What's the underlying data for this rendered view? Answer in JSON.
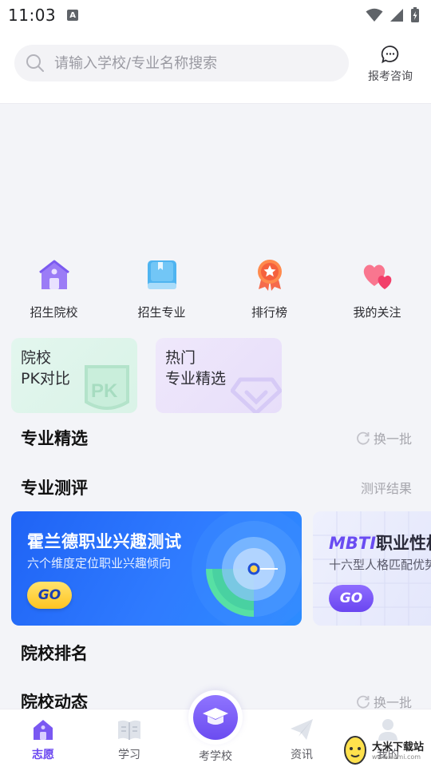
{
  "status_bar": {
    "time": "11:03",
    "notification_letter": "A"
  },
  "header": {
    "search_placeholder": "请输入学校/专业名称搜索",
    "consult_label": "报考咨询"
  },
  "quick_links": [
    {
      "label": "招生院校",
      "icon": "school-building-icon"
    },
    {
      "label": "招生专业",
      "icon": "book-icon"
    },
    {
      "label": "排行榜",
      "icon": "ranking-medal-icon"
    },
    {
      "label": "我的关注",
      "icon": "hearts-icon"
    }
  ],
  "feature_cards": [
    {
      "line1": "院校",
      "line2": "PK对比",
      "deco": "PK"
    },
    {
      "line1": "热门",
      "line2": "专业精选"
    }
  ],
  "sections": {
    "major_picks": {
      "title": "专业精选",
      "action": "换一批"
    },
    "major_test": {
      "title": "专业测评",
      "action": "测评结果"
    },
    "school_rank": {
      "title": "院校排名"
    },
    "school_news": {
      "title": "院校动态",
      "action": "换一批"
    }
  },
  "tests": [
    {
      "title": "霍兰德职业兴趣测试",
      "subtitle": "六个维度定位职业兴趣倾向",
      "button": "GO"
    },
    {
      "title_prefix": "MBTI",
      "title_rest": "职业性格",
      "subtitle": "十六型人格匹配优势",
      "button": "GO"
    }
  ],
  "tabbar": [
    {
      "label": "志愿",
      "active": true
    },
    {
      "label": "学习",
      "active": false
    },
    {
      "label": "考学校",
      "active": false
    },
    {
      "label": "资讯",
      "active": false
    },
    {
      "label": "我的",
      "active": false
    }
  ],
  "watermark": {
    "text": "大米下载站",
    "url": "www.dami.com"
  },
  "colors": {
    "accent": "#6a46f0",
    "holland_blue": "#2f7bff",
    "go_yellow": "#ffc421"
  }
}
